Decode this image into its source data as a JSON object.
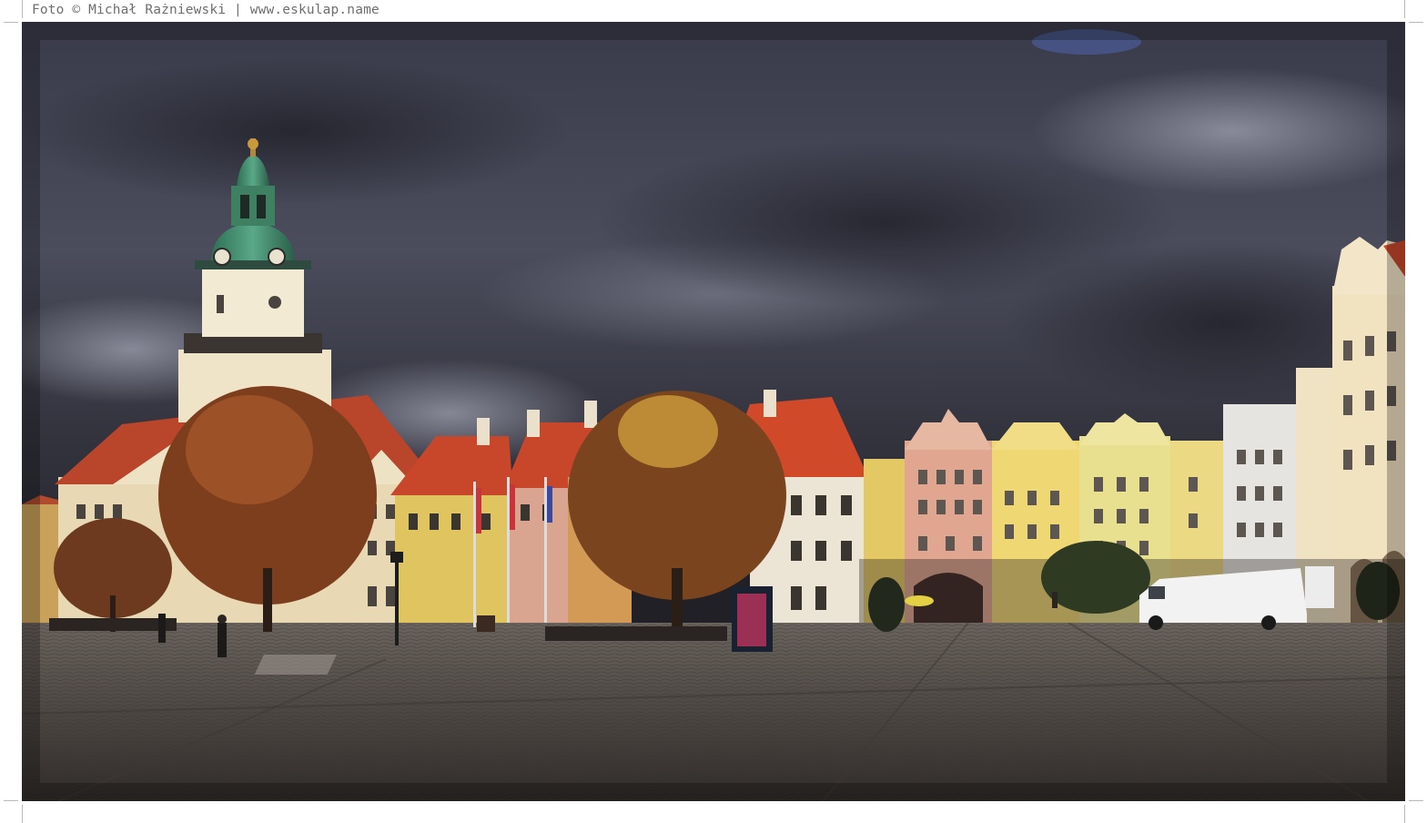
{
  "caption": {
    "text": "Foto © Michał Rażniewski | www.eskulap.name"
  },
  "photo": {
    "scene": "town-square-with-town-hall-under-storm-clouds",
    "colors": {
      "sky_dark": "#2f2f3d",
      "sky_light": "#7f8191",
      "roof": "#c8472b",
      "dome": "#3d8a6a",
      "pavement": "#5a5450",
      "tree_autumn": "#8a4a22"
    }
  }
}
